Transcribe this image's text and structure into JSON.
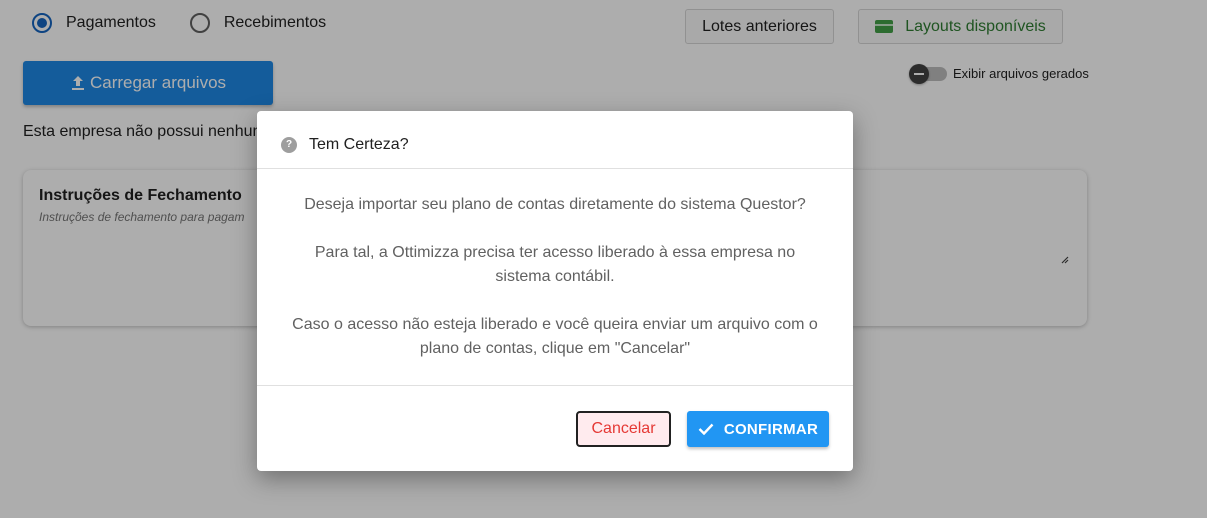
{
  "page": {
    "radios": [
      {
        "label": "Pagamentos",
        "checked": true
      },
      {
        "label": "Recebimentos",
        "checked": false
      }
    ],
    "lotes_label": "Lotes anteriores",
    "layouts_label": "Layouts disponíveis",
    "upload_label": "Carregar arquivos",
    "toggle_label": "Exibir arquivos gerados",
    "empty_text": "Esta empresa não possui nenhum",
    "instructions": {
      "title": "Instruções de Fechamento",
      "subtitle": "Instruções de fechamento para pagam"
    }
  },
  "dialog": {
    "title": "Tem Certeza?",
    "paragraphs": [
      "Deseja importar seu plano de contas diretamente do sistema Questor?",
      "Para tal, a Ottimizza precisa ter acesso liberado à essa empresa no sistema contábil.",
      "Caso o acesso não esteja liberado e você queira enviar um arquivo com o plano de contas, clique em \"Cancelar\""
    ],
    "cancel_label": "Cancelar",
    "confirm_label": "CONFIRMAR"
  },
  "colors": {
    "primary": "#1e88e5",
    "confirm": "#2196f3",
    "cancel_text": "#e53935",
    "layouts_green": "#2e7d32"
  }
}
